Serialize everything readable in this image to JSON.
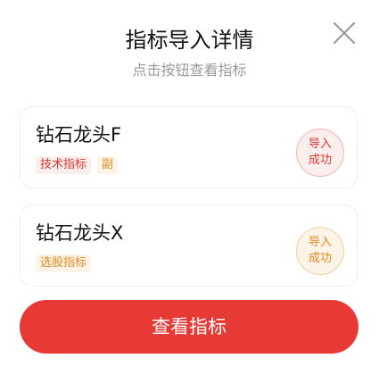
{
  "dialog": {
    "title": "指标导入详情",
    "subtitle": "点击按钮查看指标",
    "close_icon": "close-icon"
  },
  "items": [
    {
      "name": "钻石龙头F",
      "tags": [
        "技术指标",
        "副"
      ],
      "tag_color": "#e0372f",
      "status": "导入成功",
      "status_color": "#e0372f"
    },
    {
      "name": "钻石龙头X",
      "tags": [
        "选股指标"
      ],
      "tag_color": "#e48a1f",
      "status": "导入成功",
      "status_color": "#e48a1f"
    }
  ],
  "primary_button": {
    "label": "查看指标",
    "color": "#e83a34"
  }
}
